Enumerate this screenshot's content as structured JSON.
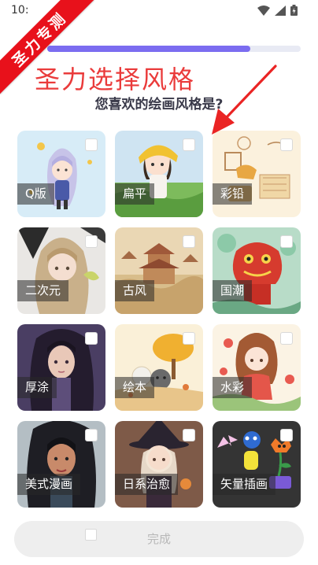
{
  "status_bar": {
    "time": "10:",
    "icons": [
      "wifi-icon",
      "cell-signal-icon",
      "battery-icon"
    ]
  },
  "ribbon": {
    "text": "圣力专测"
  },
  "progress": {
    "value": 0.8
  },
  "header": {
    "overlay_title": "圣力选择风格",
    "question": "您喜欢的绘画风格是?"
  },
  "styles": [
    {
      "label": "Q版",
      "checked": false
    },
    {
      "label": "扁平",
      "checked": false
    },
    {
      "label": "彩铅",
      "checked": false
    },
    {
      "label": "二次元",
      "checked": false
    },
    {
      "label": "古风",
      "checked": false
    },
    {
      "label": "国潮",
      "checked": false
    },
    {
      "label": "厚涂",
      "checked": false
    },
    {
      "label": "绘本",
      "checked": false
    },
    {
      "label": "水彩",
      "checked": false
    },
    {
      "label": "美式漫画",
      "checked": false
    },
    {
      "label": "日系治愈",
      "checked": false
    },
    {
      "label": "矢量插画",
      "checked": false
    }
  ],
  "footer": {
    "finish_label": "完成"
  },
  "colors": {
    "accent": "#7b6cf0",
    "red": "#ea3b3b",
    "ribbon": "#e8111b",
    "button_bg": "#eeeeee"
  }
}
